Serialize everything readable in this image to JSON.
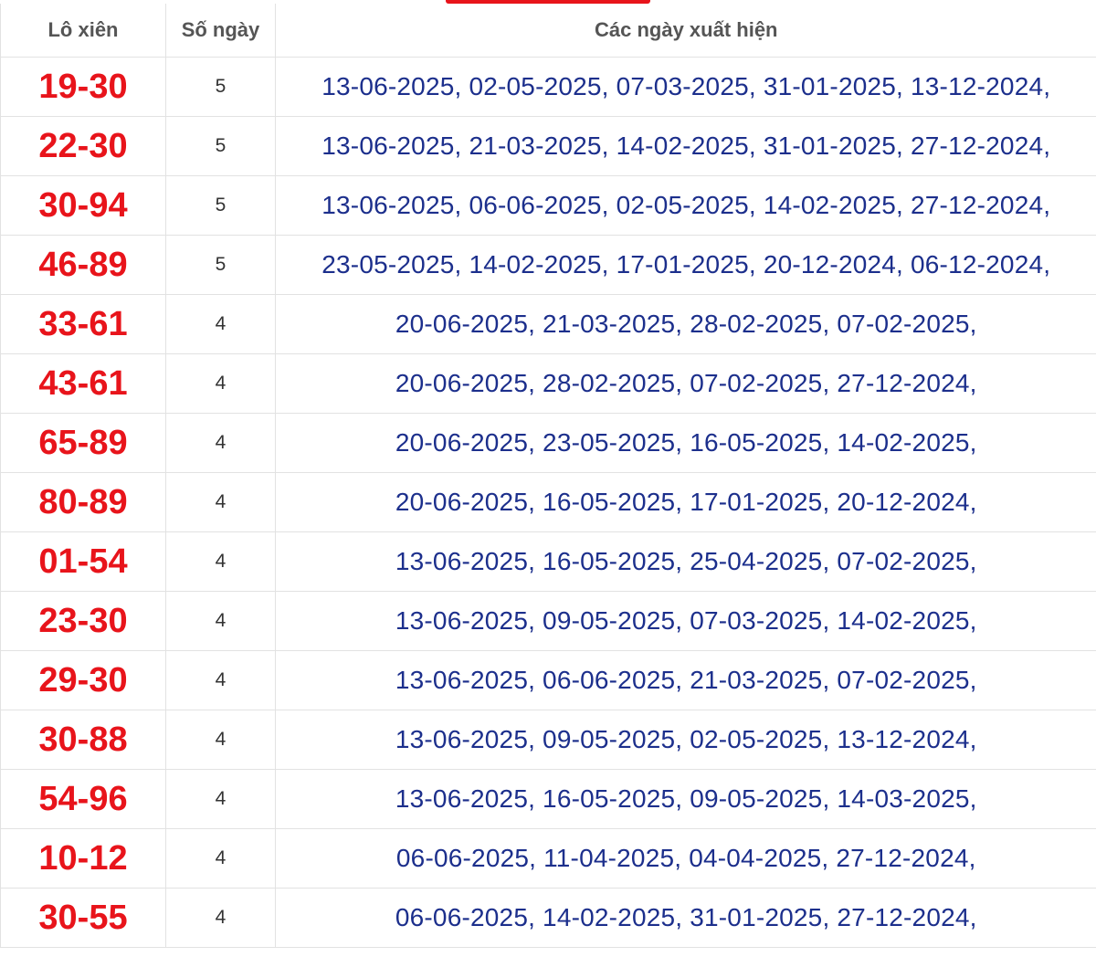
{
  "header": {
    "col_pair": "Lô xiên",
    "col_count": "Số ngày",
    "col_dates": "Các ngày xuất hiện"
  },
  "accent_color": "#e8141b",
  "rows": [
    {
      "pair": "19-30",
      "count": "5",
      "dates": "13-06-2025, 02-05-2025, 07-03-2025, 31-01-2025, 13-12-2024,"
    },
    {
      "pair": "22-30",
      "count": "5",
      "dates": "13-06-2025, 21-03-2025, 14-02-2025, 31-01-2025, 27-12-2024,"
    },
    {
      "pair": "30-94",
      "count": "5",
      "dates": "13-06-2025, 06-06-2025, 02-05-2025, 14-02-2025, 27-12-2024,"
    },
    {
      "pair": "46-89",
      "count": "5",
      "dates": "23-05-2025, 14-02-2025, 17-01-2025, 20-12-2024, 06-12-2024,"
    },
    {
      "pair": "33-61",
      "count": "4",
      "dates": "20-06-2025, 21-03-2025, 28-02-2025, 07-02-2025,"
    },
    {
      "pair": "43-61",
      "count": "4",
      "dates": "20-06-2025, 28-02-2025, 07-02-2025, 27-12-2024,"
    },
    {
      "pair": "65-89",
      "count": "4",
      "dates": "20-06-2025, 23-05-2025, 16-05-2025, 14-02-2025,"
    },
    {
      "pair": "80-89",
      "count": "4",
      "dates": "20-06-2025, 16-05-2025, 17-01-2025, 20-12-2024,"
    },
    {
      "pair": "01-54",
      "count": "4",
      "dates": "13-06-2025, 16-05-2025, 25-04-2025, 07-02-2025,"
    },
    {
      "pair": "23-30",
      "count": "4",
      "dates": "13-06-2025, 09-05-2025, 07-03-2025, 14-02-2025,"
    },
    {
      "pair": "29-30",
      "count": "4",
      "dates": "13-06-2025, 06-06-2025, 21-03-2025, 07-02-2025,"
    },
    {
      "pair": "30-88",
      "count": "4",
      "dates": "13-06-2025, 09-05-2025, 02-05-2025, 13-12-2024,"
    },
    {
      "pair": "54-96",
      "count": "4",
      "dates": "13-06-2025, 16-05-2025, 09-05-2025, 14-03-2025,"
    },
    {
      "pair": "10-12",
      "count": "4",
      "dates": "06-06-2025, 11-04-2025, 04-04-2025, 27-12-2024,"
    },
    {
      "pair": "30-55",
      "count": "4",
      "dates": "06-06-2025, 14-02-2025, 31-01-2025, 27-12-2024,"
    }
  ]
}
